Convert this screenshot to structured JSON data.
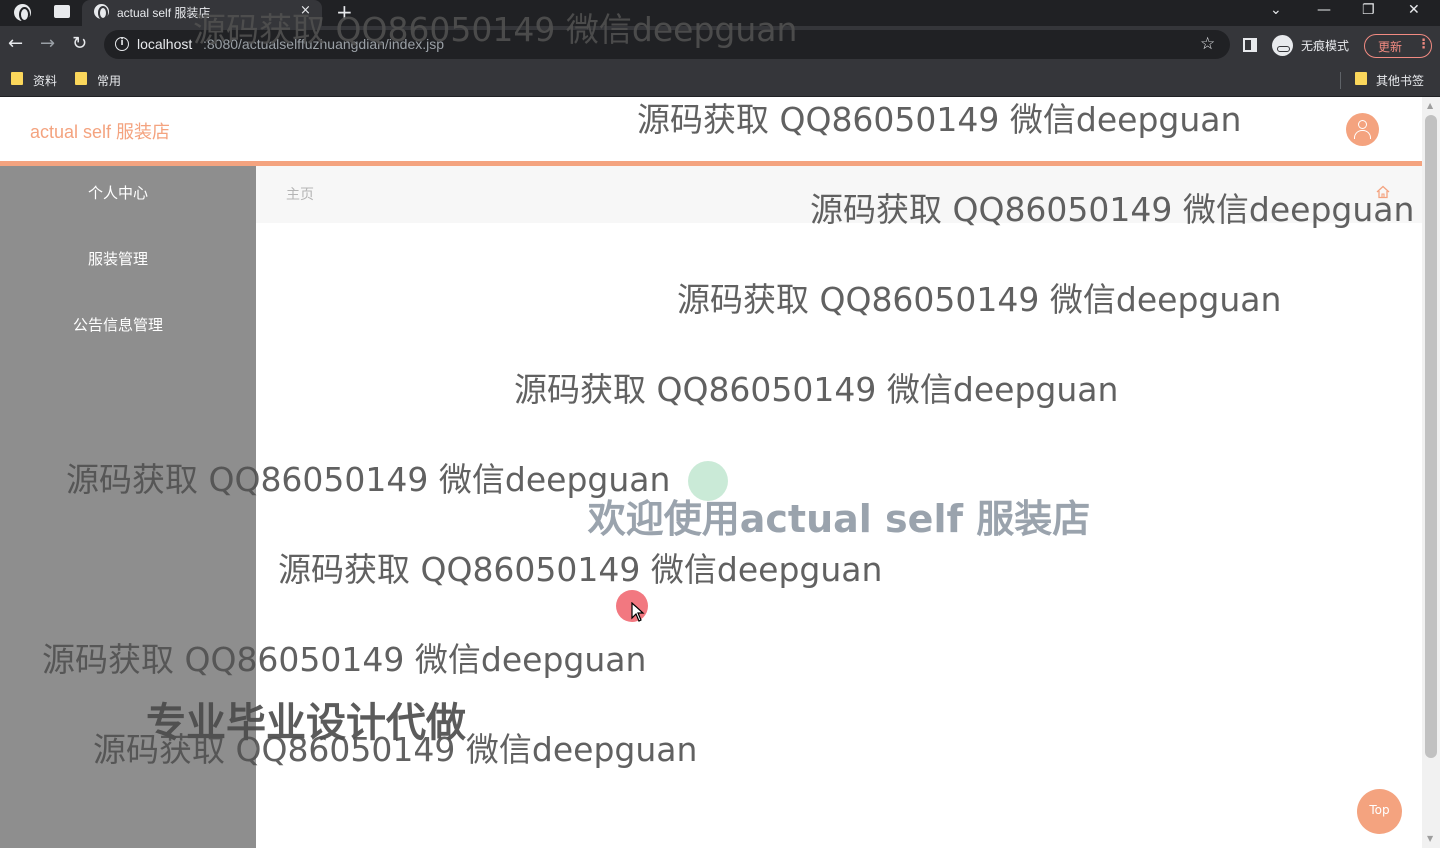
{
  "browser": {
    "tab_title": "actual self 服装店",
    "tab_close": "×",
    "new_tab": "+",
    "window_controls": [
      "⌄",
      "—",
      "❐",
      "✕"
    ],
    "nav": {
      "back": "←",
      "forward": "→",
      "reload": "↻"
    },
    "url_host": "localhost",
    "url_path": ":8080/actualselffuzhuangdian/index.jsp",
    "star": "☆",
    "incognito_label": "无痕模式",
    "update_label": "更新",
    "update_menu": "⋮",
    "bookmarks": [
      "资料",
      "常用"
    ],
    "other_bookmarks": "其他书签"
  },
  "app": {
    "brand": "actual self 服装店",
    "sidebar": {
      "items": [
        {
          "label": "个人中心"
        },
        {
          "label": "服装管理"
        },
        {
          "label": "公告信息管理"
        }
      ]
    },
    "breadcrumb": "主页",
    "welcome": "欢迎使用actual self 服装店",
    "top_button": "Top"
  },
  "watermark": {
    "text": "源码获取 QQ86050149 微信deepguan",
    "overlay_text": "专业毕业设计代做"
  },
  "colors": {
    "accent": "#f4a37f",
    "sidebar_bg": "#8e8e8e",
    "chrome_dark": "#202124",
    "chrome_toolbar": "#35363a"
  },
  "icons": [
    "globe-icon",
    "info-icon",
    "star-icon",
    "side-panel-icon",
    "incognito-icon",
    "folder-icon",
    "user-icon",
    "home-icon",
    "cursor-icon"
  ]
}
